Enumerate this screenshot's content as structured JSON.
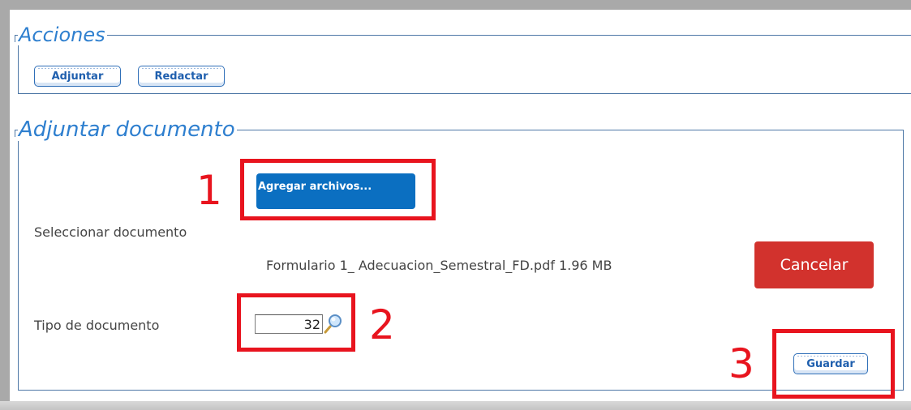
{
  "acciones": {
    "legend": "Acciones",
    "adjuntar_label": "Adjuntar",
    "redactar_label": "Redactar"
  },
  "adjuntar_documento": {
    "legend": "Adjuntar documento",
    "agregar_label": "Agregar archivos...",
    "seleccionar_label": "Seleccionar documento",
    "file_name": "Formulario 1_ Adecuacion_Semestral_FD.pdf",
    "file_size": "1.96 MB",
    "cancelar_label": "Cancelar",
    "tipo_label": "Tipo de documento",
    "tipo_value": "32",
    "guardar_label": "Guardar"
  },
  "annotations": {
    "step1": "1",
    "step2": "2",
    "step3": "3"
  },
  "colors": {
    "annotation": "#e8141e",
    "legend": "#2e7fcf",
    "primary_button": "#0b6fc1",
    "danger_button": "#d2322d"
  },
  "icons": {
    "lookup": "magnifier-icon"
  }
}
